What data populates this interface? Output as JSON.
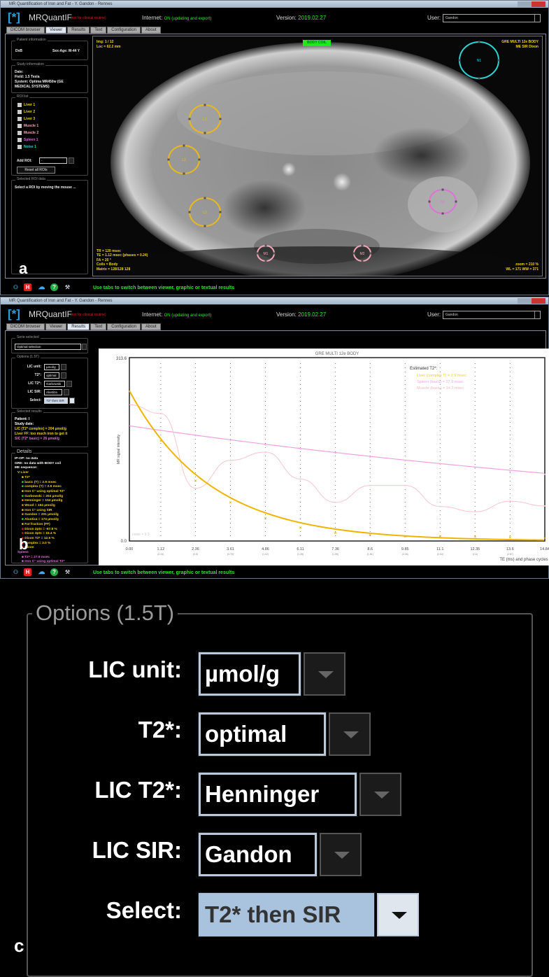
{
  "app": {
    "window_title": "MR Quantification of Iron and Fat - Y. Gandon - Rennes",
    "name": "MRQuantIF",
    "logo": "[*]",
    "disclaimer": "(not for clinical routine)",
    "internet_label": "Internet:",
    "internet_status": "ON (updating and export)",
    "version_label": "Version:",
    "version": "2019.02.27",
    "user_label": "User:",
    "user": "Gandon",
    "tabs": [
      "DICOM browser",
      "Viewer",
      "Results",
      "Text",
      "Configuration",
      "About"
    ],
    "status_message": "Use tabs to switch between viewer, graphic or textual results",
    "status_icons": [
      "users-icon",
      "h-logo-icon",
      "cloud-upload-icon",
      "help-icon",
      "network-icon"
    ]
  },
  "panel_a": {
    "letter": "a",
    "active_tab": "Viewer",
    "patient": {
      "legend": "Patient information",
      "name": "DxB",
      "sex_age": "Sex-Age: M-44 Y"
    },
    "study": {
      "legend": "Study information",
      "lines": [
        "Date:",
        "Field: 1.5 Tesla",
        "System: Optima MR450w (GE",
        "MEDICAL SYSTEMS)"
      ]
    },
    "roi_list": {
      "legend": "ROI list",
      "items": [
        {
          "label": "Liver 1",
          "color": "#f3d21c"
        },
        {
          "label": "Liver 2",
          "color": "#f3d21c"
        },
        {
          "label": "Liver 3",
          "color": "#f3d21c"
        },
        {
          "label": "Muscle 1",
          "color": "#f4a6b8"
        },
        {
          "label": "Muscle 2",
          "color": "#f4a6b8"
        },
        {
          "label": "Spleen 1",
          "color": "#e060e0"
        },
        {
          "label": "Noise 1",
          "color": "#2ad4d4"
        }
      ],
      "add_label": "Add ROI:",
      "add_value": "-",
      "reset_label": "Reset all ROIs"
    },
    "selected_roi": {
      "legend": "Selected ROI data",
      "text": "Select a ROI by moving the mouse ..."
    },
    "viewer": {
      "coil_badge": "BODY COIL",
      "top_left": [
        "Img: 1 / 12",
        "Loc = 62.2 mm"
      ],
      "top_right": [
        "GRE MULTI 12e BODY",
        "ME SIR Dixon"
      ],
      "bottom_left": [
        "TR = 120 msec",
        "TE = 1.12 msec (phases = 0.24)",
        "FA = 20 °",
        "Coils = Body",
        "Matrix = 128/128 128"
      ],
      "bottom_right": [
        "zoom = 210 %",
        "WL = 171 WW = 371"
      ],
      "rois": [
        {
          "label": "L1",
          "color": "#e8b81c"
        },
        {
          "label": "L2",
          "color": "#e8b81c"
        },
        {
          "label": "L3",
          "color": "#e8b81c"
        },
        {
          "label": "M1",
          "color": "#f4a6b8"
        },
        {
          "label": "M2",
          "color": "#f4a6b8"
        },
        {
          "label": "S1",
          "color": "#e070d8"
        },
        {
          "label": "N1",
          "color": "#2ad4d4"
        }
      ]
    }
  },
  "panel_b": {
    "letter": "b",
    "active_tab": "Results",
    "serie": {
      "legend": "Serie selected",
      "value": "Optimal selection"
    },
    "options": {
      "legend": "Options (1.5T)",
      "rows": [
        {
          "label": "LIC unit:",
          "value": "µmol/g"
        },
        {
          "label": "T2*:",
          "value": "optimal"
        },
        {
          "label": "LIC T2*:",
          "value": "Garbowski"
        },
        {
          "label": "LIC SIR:",
          "value": "Alustiza"
        },
        {
          "label": "Select:",
          "value": "T2* then SIR"
        }
      ]
    },
    "selected_results": {
      "legend": "Selected results",
      "lines": [
        {
          "text": "Patient: I",
          "color": "#ffffff"
        },
        {
          "text": "Study date:",
          "color": "#ffffff"
        },
        {
          "text": "LIC (T2* complex) = 204 µmol/g",
          "color": "#f3d21c"
        },
        {
          "text": "Liver FF: too much iron to get it",
          "color": "#f3d21c"
        },
        {
          "text": "SIC (T2* basic) = 26 µmol/g",
          "color": "#e070d8"
        }
      ]
    },
    "details": {
      "legend": "Details",
      "lines": [
        {
          "text": "IP-OP: no data",
          "color": "#ffffff",
          "bullet": ""
        },
        {
          "text": "GRE: no data with BODY coil",
          "color": "#ffffff",
          "bullet": ""
        },
        {
          "text": "ME sequence:",
          "color": "#ffffff",
          "bullet": ""
        },
        {
          "text": "V Liver",
          "color": "#f3d21c",
          "bullet": ""
        },
        {
          "text": "T2*",
          "color": "#f3d21c",
          "bullet": "#f3d21c"
        },
        {
          "text": "basic (T) = 2.9 msec",
          "color": "#f3d21c",
          "bullet": "#2ee82e"
        },
        {
          "text": "complex (T) = 2.9 msec",
          "color": "#f3d21c",
          "bullet": "#2ee82e"
        },
        {
          "text": "Iron C° using optimal T2*",
          "color": "#f3d21c",
          "bullet": "#f3d21c"
        },
        {
          "text": "Garbowski = 204 µmol/g",
          "color": "#f3d21c",
          "bullet": "#2ee82e"
        },
        {
          "text": "Henninger = 154 µmol/g",
          "color": "#f3d21c",
          "bullet": "#f39a1c"
        },
        {
          "text": "Wood = 164 µmol/g",
          "color": "#f3d21c",
          "bullet": "#f39a1c"
        },
        {
          "text": "Iron C° using SIR",
          "color": "#f3d21c",
          "bullet": "#f3d21c"
        },
        {
          "text": "Gandon = 201 µmol/g",
          "color": "#f3d21c",
          "bullet": "#f39a1c"
        },
        {
          "text": "Alustiza = 174 µmol/g",
          "color": "#f3d21c",
          "bullet": "#2ee82e"
        },
        {
          "text": "Fat fraction (FF)",
          "color": "#f3d21c",
          "bullet": "#f3d21c"
        },
        {
          "text": "Dixon 2pts = -67.8 %",
          "color": "#f3d21c",
          "bullet": "#e02020"
        },
        {
          "text": "Dixon 3pts = 15.4 %",
          "color": "#f3d21c",
          "bullet": "#e02020"
        },
        {
          "text": "Dixon T2* = 12.5 %",
          "color": "#f3d21c",
          "bullet": "#e02020"
        },
        {
          "text": "complex = 3.0 %",
          "color": "#f3d21c",
          "bullet": "#e02020"
        },
        {
          "text": "Dixon",
          "color": "#f3d21c",
          "bullet": "#e02020"
        },
        {
          "text": "Spleen",
          "color": "#e070d8",
          "bullet": ""
        },
        {
          "text": "T2* = 27.9 msec",
          "color": "#e070d8",
          "bullet": "#e070d8"
        },
        {
          "text": "Iron C° using optimal T2*",
          "color": "#e070d8",
          "bullet": "#e070d8"
        },
        {
          "text": "Garbowski = 26 µmol/g",
          "color": "#e070d8",
          "bullet": "#e02020"
        },
        {
          "text": "Henninger = 20 µmol/g",
          "color": "#e070d8",
          "bullet": "#e02020"
        },
        {
          "text": "Wood = 14 µmol/g",
          "color": "#e070d8",
          "bullet": "#e02020"
        }
      ]
    }
  },
  "chart_data": {
    "type": "line",
    "title": "GRE MULTI 12e BODY",
    "xlabel": "TE (ms) and phase cycles",
    "ylabel": "MR signal intensity",
    "ylim": [
      0,
      313.6
    ],
    "xlim": [
      0,
      14.84
    ],
    "x_ticks": [
      "0.00",
      "1.12",
      "2.36",
      "3.61",
      "4.86",
      "6.11",
      "7.36",
      "8.6",
      "9.85",
      "11.1",
      "12.35",
      "13.6",
      "14.84"
    ],
    "phase_cycles": [
      "",
      "(0.24)",
      "(0.5)",
      "(0.76)",
      "(1.02)",
      "(1.28)",
      "(1.55)",
      "(1.81)",
      "(2.06)",
      "(2.34)",
      "(2.6)",
      "(2.87)",
      ""
    ],
    "y_tick_labels": [
      "313.6",
      "0.0"
    ],
    "noise_label": "noise = 9.3",
    "legend_title": "Estimated T2*:",
    "legend_position": "top-right",
    "x": [
      1.12,
      2.36,
      3.61,
      4.86,
      6.11,
      7.36,
      8.6,
      9.85,
      11.1,
      12.35,
      13.6,
      14.84
    ],
    "series": [
      {
        "name": "Liver (complex T) = 2.9 msec",
        "color": "#f0b400",
        "fit": {
          "S0": 257,
          "T2star": 2.9
        },
        "values": [
          171,
          103,
          66,
          39,
          23,
          14,
          10,
          8,
          8,
          7,
          6,
          5
        ]
      },
      {
        "name": "Spleen (basic) = 27.9 msec",
        "color": "#f0a0e0",
        "fit": {
          "S0": 197,
          "T2star": 27.9
        },
        "values": [
          189,
          180,
          172,
          164,
          157,
          150,
          143,
          137,
          131,
          125,
          119,
          114
        ]
      },
      {
        "name": "Muscle (basic) = 14.2 msec",
        "color": "#f6c6cc",
        "values_at_0": 233,
        "values": [
          218,
          90,
          138,
          152,
          106,
          66,
          95,
          95,
          59,
          50,
          68,
          60
        ]
      }
    ]
  },
  "panel_c": {
    "letter": "c",
    "legend": "Options (1.5T)",
    "rows": [
      {
        "label": "LIC unit:",
        "value": "µmol/g"
      },
      {
        "label": "T2*:",
        "value": "optimal"
      },
      {
        "label": "LIC T2*:",
        "value": "Henninger"
      },
      {
        "label": "LIC SIR:",
        "value": "Gandon"
      },
      {
        "label": "Select:",
        "value": "T2* then SIR"
      }
    ]
  }
}
